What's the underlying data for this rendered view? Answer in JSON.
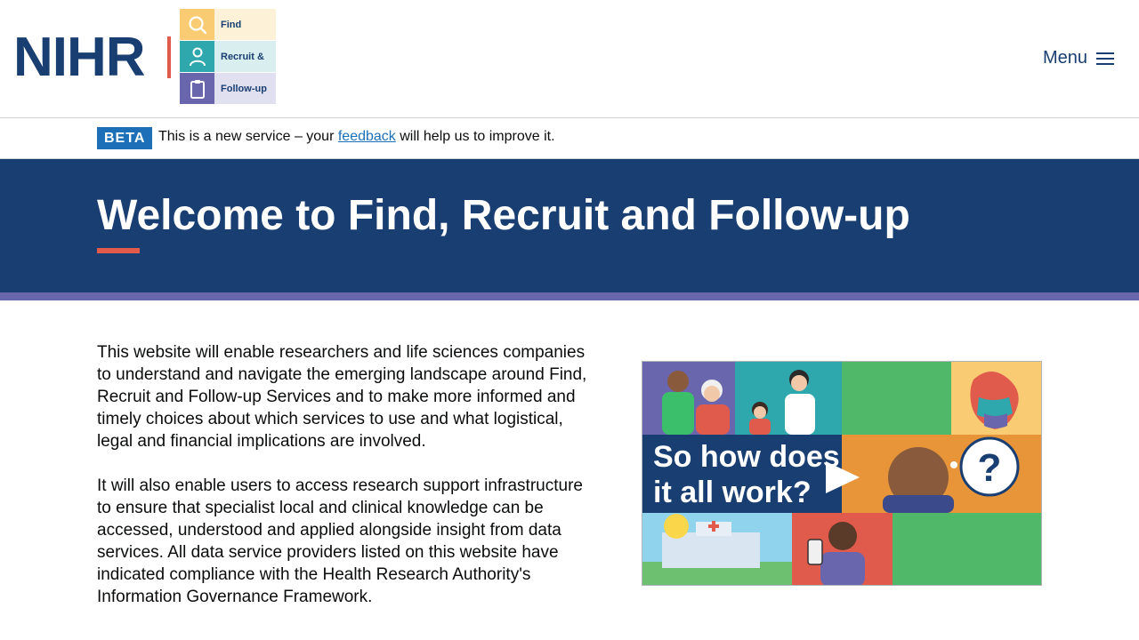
{
  "header": {
    "logo_text": "NIHR",
    "tiles": [
      "Find",
      "Recruit &",
      "Follow-up"
    ],
    "menu_label": "Menu"
  },
  "beta": {
    "tag": "BETA",
    "text_before": "This is a new service – your ",
    "link": "feedback",
    "text_after": " will help us to improve it."
  },
  "hero": {
    "title": "Welcome to Find, Recruit and Follow-up"
  },
  "content": {
    "paragraphs": [
      "This website will enable researchers and life sciences companies to understand and navigate the emerging landscape around Find, Recruit and Follow-up Services and to make more informed and timely choices about which services to use and what logistical, legal and financial implications are involved.",
      "It will also enable users to access research support infrastructure to ensure that specialist local and clinical knowledge can be accessed, understood and applied alongside insight from data services. All data service providers listed on this website have indicated compliance with the Health Research Authority's Information Governance Framework."
    ]
  },
  "video": {
    "caption_line1": "So how does",
    "caption_line2": "it all work?",
    "question_mark": "?"
  },
  "colors": {
    "brand_navy": "#193e72",
    "accent_coral": "#e05b4c",
    "band_purple": "#6a66ae",
    "link_blue": "#1d70b8"
  }
}
